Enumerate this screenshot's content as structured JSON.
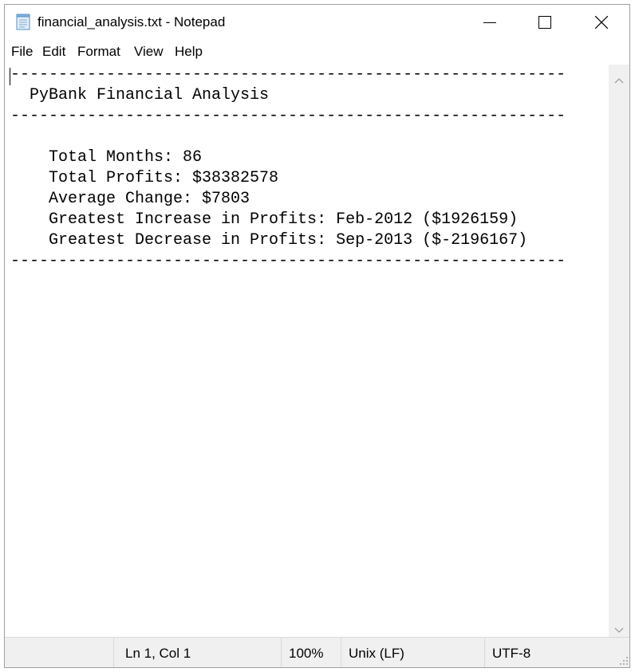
{
  "window": {
    "title": "financial_analysis.txt - Notepad",
    "app_icon": "notepad-icon"
  },
  "title_buttons": {
    "minimize_icon": "minimize-icon",
    "maximize_icon": "maximize-icon",
    "close_icon": "close-icon"
  },
  "menu": {
    "items": [
      {
        "label": "File"
      },
      {
        "label": "Edit"
      },
      {
        "label": "Format"
      },
      {
        "label": "View"
      },
      {
        "label": "Help"
      }
    ]
  },
  "editor": {
    "lines": [
      "----------------------------------------------------------",
      "  PyBank Financial Analysis",
      "----------------------------------------------------------",
      "",
      "    Total Months: 86",
      "    Total Profits: $38382578",
      "    Average Change: $7803",
      "    Greatest Increase in Profits: Feb-2012 ($1926159)",
      "    Greatest Decrease in Profits: Sep-2013 ($-2196167)",
      "----------------------------------------------------------"
    ]
  },
  "status": {
    "position": "Ln 1, Col 1",
    "zoom": "100%",
    "line_ending": "Unix (LF)",
    "encoding": "UTF-8"
  },
  "colors": {
    "chrome_background": "#f0f0f0",
    "text": "#000000",
    "editor_background": "#ffffff"
  }
}
